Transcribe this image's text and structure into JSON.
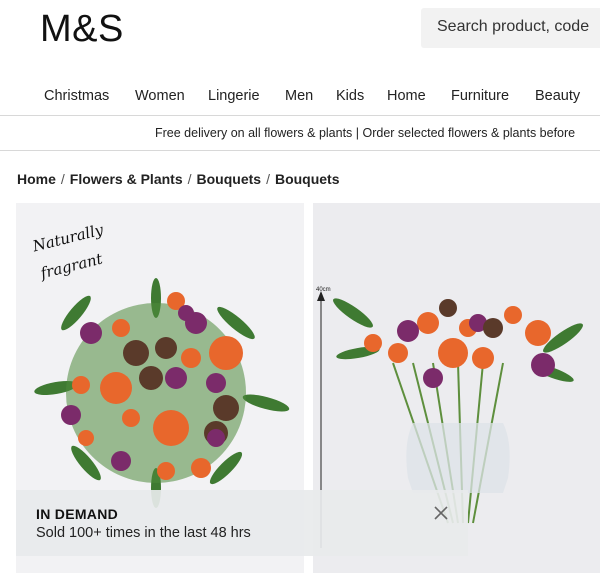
{
  "header": {
    "logo": "M&S",
    "search_placeholder": "Search product, code"
  },
  "nav": {
    "items": [
      "Christmas",
      "Women",
      "Lingerie",
      "Men",
      "Kids",
      "Home",
      "Furniture",
      "Beauty"
    ]
  },
  "promo": {
    "text": "Free delivery on all flowers & plants  |  Order selected flowers & plants before"
  },
  "breadcrumb": {
    "items": [
      "Home",
      "Flowers & Plants",
      "Bouquets",
      "Bouquets"
    ],
    "separator": "/"
  },
  "gallery": {
    "image1_tag_line1": "Naturally",
    "image1_tag_line2": "fragrant",
    "image2_measure": "40cm"
  },
  "banner": {
    "title": "IN DEMAND",
    "text": "Sold 100+ times in the last 48 hrs"
  },
  "colors": {
    "orange": "#e8672c",
    "purple": "#7b2b6a",
    "leaf": "#3f7a32",
    "pinecone": "#5a3a2a"
  }
}
